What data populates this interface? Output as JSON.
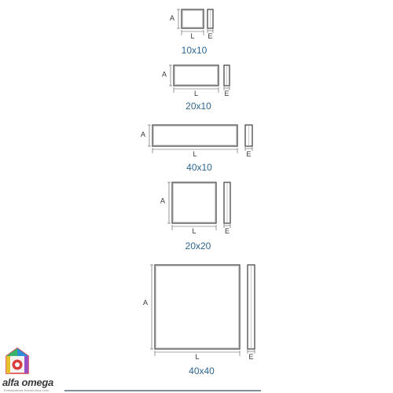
{
  "labels": {
    "height": "A",
    "length": "L",
    "thickness": "E"
  },
  "tiles": [
    {
      "size": "10x10"
    },
    {
      "size": "20x10"
    },
    {
      "size": "40x10"
    },
    {
      "size": "20x20"
    },
    {
      "size": "40x40"
    }
  ],
  "logo": {
    "name": "alfa omega",
    "tagline": "Embaladeiras Reembolsos Ltda"
  },
  "colors": {
    "caption": "#2e6690",
    "outline": "#3a3a3a",
    "footer_line": "#5a6b7b"
  }
}
